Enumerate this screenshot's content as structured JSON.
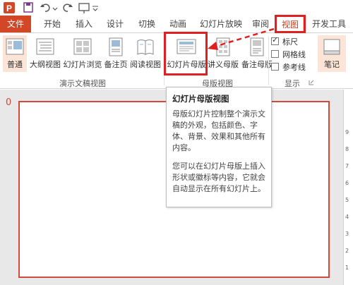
{
  "tabs": {
    "file": "文件",
    "home": "开始",
    "insert": "插入",
    "design": "设计",
    "transitions": "切换",
    "animations": "动画",
    "slideshow": "幻灯片放映",
    "review": "审阅",
    "view": "视图",
    "developer": "开发工具"
  },
  "ribbon": {
    "normal": "普通",
    "outline_view": "大纲视图",
    "slide_sorter": "幻灯片浏览",
    "notes_page": "备注页",
    "reading_view": "阅读视图",
    "presentation_views_group": "演示文稿视图",
    "slide_master": "幻灯片母版",
    "handout_master": "讲义母版",
    "notes_master": "备注母版",
    "master_views_group": "母版视图",
    "ruler": "标尺",
    "gridlines": "网格线",
    "guides": "参考线",
    "ruler_checked": true,
    "gridlines_checked": false,
    "guides_checked": false,
    "show_group": "显示",
    "notes": "笔记"
  },
  "tooltip": {
    "title": "幻灯片母版视图",
    "para1": "母版幻灯片控制整个演示文稿的外观，包括颜色、字体、背景、效果和其他所有内容。",
    "para2": "您可以在幻灯片母版上插入形状或徽标等内容，它就会自动显示在所有幻灯片上。"
  },
  "slide": {
    "number": "0"
  },
  "ruler_marks": [
    "9",
    "8",
    "7",
    "6",
    "5",
    "4",
    "3",
    "2",
    "1"
  ],
  "colors": {
    "accent": "#d24726",
    "highlight": "#e02020",
    "pressed": "#fce4d6"
  }
}
